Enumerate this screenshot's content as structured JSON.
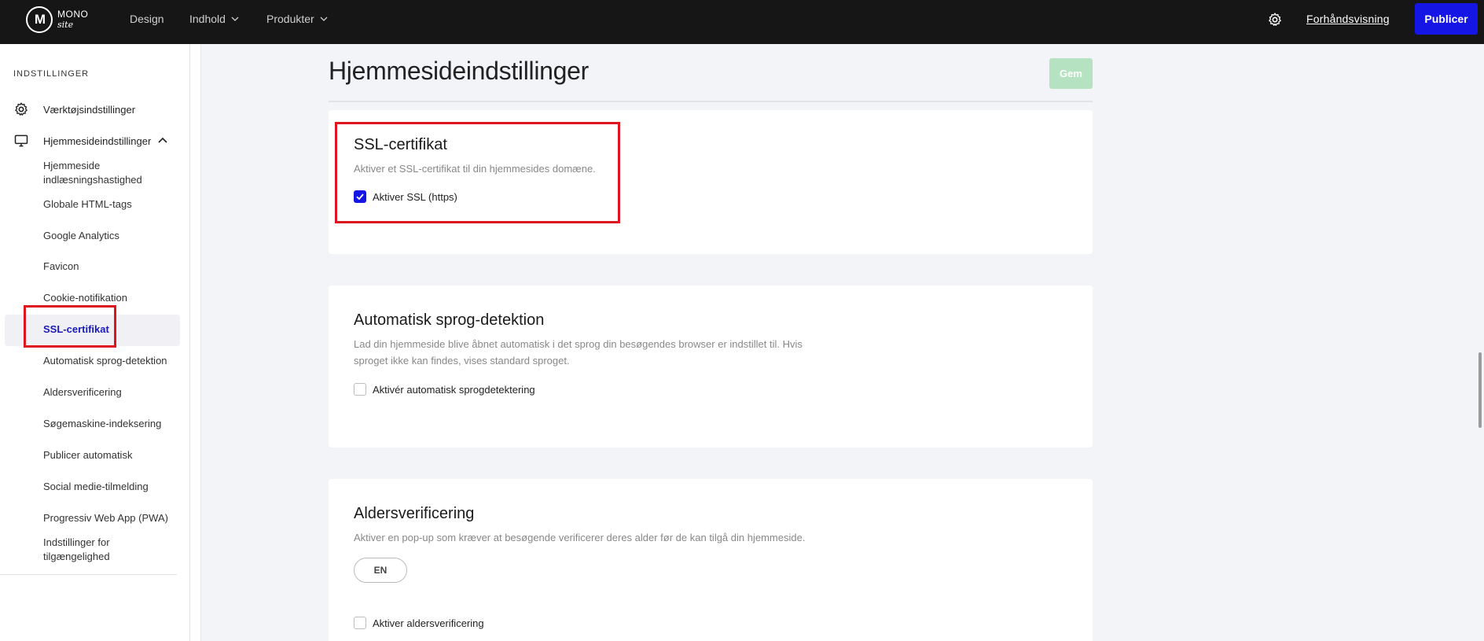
{
  "topbar": {
    "logo_line1": "MONO",
    "logo_line2": "site",
    "nav": [
      {
        "label": "Design"
      },
      {
        "label": "Indhold"
      },
      {
        "label": "Produkter"
      }
    ],
    "preview_label": "Forhåndsvisning",
    "publish_label": "Publicer"
  },
  "sidebar": {
    "heading": "INDSTILLINGER",
    "tools_label": "Værktøjsindstillinger",
    "website_label": "Hjemmesideindstillinger",
    "items": [
      {
        "label": "Hjemmeside indlæsningshastighed"
      },
      {
        "label": "Globale HTML-tags"
      },
      {
        "label": "Google Analytics"
      },
      {
        "label": "Favicon"
      },
      {
        "label": "Cookie-notifikation"
      },
      {
        "label": "SSL-certifikat",
        "active": true
      },
      {
        "label": "Automatisk sprog-detektion"
      },
      {
        "label": "Aldersverificering"
      },
      {
        "label": "Søgemaskine-indeksering"
      },
      {
        "label": "Publicer automatisk"
      },
      {
        "label": "Social medie-tilmelding"
      },
      {
        "label": "Progressiv Web App (PWA)"
      },
      {
        "label": "Indstillinger for tilgængelighed"
      }
    ]
  },
  "page": {
    "title": "Hjemmesideindstillinger",
    "save_label": "Gem"
  },
  "ssl": {
    "title": "SSL-certifikat",
    "description": "Aktiver et SSL-certifikat til din hjemmesides domæne.",
    "checkbox_label": "Aktiver SSL (https)",
    "checked": true
  },
  "lang_detect": {
    "title": "Automatisk sprog-detektion",
    "description": "Lad din hjemmeside blive åbnet automatisk i det sprog din besøgendes browser er indstillet til. Hvis sproget ikke kan findes, vises standard sproget.",
    "checkbox_label": "Aktivér automatisk sprogdetektering",
    "checked": false
  },
  "age": {
    "title": "Aldersverificering",
    "description": "Aktiver en pop-up som kræver at besøgende verificerer deres alder før de kan tilgå din hjemmeside.",
    "language_pill": "EN",
    "checkbox_label": "Aktiver aldersverificering",
    "checked": false
  },
  "colors": {
    "accent": "#1515e6",
    "highlight": "#e0141e",
    "save_disabled": "#b5e2c0"
  }
}
